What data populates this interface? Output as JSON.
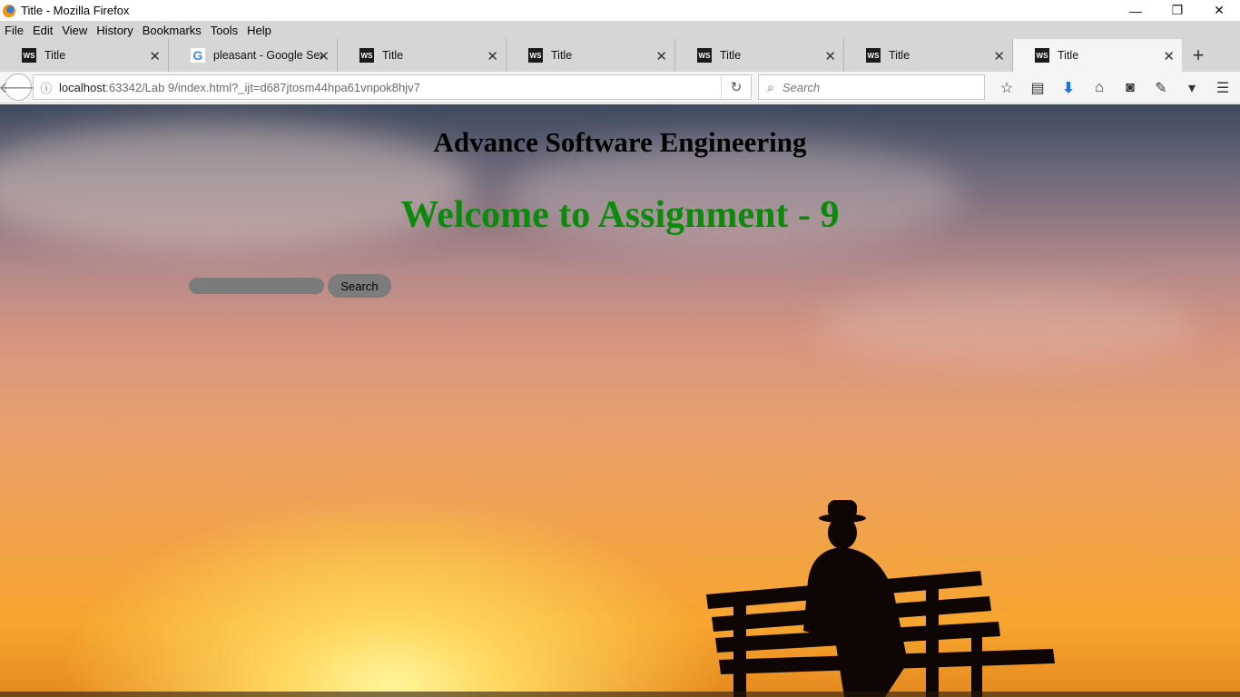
{
  "window": {
    "title": "Title - Mozilla Firefox",
    "controls": {
      "minimize": "—",
      "restore": "❐",
      "close": "✕"
    }
  },
  "menu": [
    {
      "label": "File",
      "key": "F"
    },
    {
      "label": "Edit",
      "key": "E"
    },
    {
      "label": "View",
      "key": "V"
    },
    {
      "label": "History",
      "key": "s"
    },
    {
      "label": "Bookmarks",
      "key": "B"
    },
    {
      "label": "Tools",
      "key": "T"
    },
    {
      "label": "Help",
      "key": "H"
    }
  ],
  "tabs": [
    {
      "label": "Title",
      "icon": "webstorm-icon",
      "active": false
    },
    {
      "label": "pleasant - Google Sea...",
      "icon": "google-icon",
      "active": false
    },
    {
      "label": "Title",
      "icon": "webstorm-icon",
      "active": false
    },
    {
      "label": "Title",
      "icon": "webstorm-icon",
      "active": false
    },
    {
      "label": "Title",
      "icon": "webstorm-icon",
      "active": false
    },
    {
      "label": "Title",
      "icon": "webstorm-icon",
      "active": false
    },
    {
      "label": "Title",
      "icon": "webstorm-icon",
      "active": true
    }
  ],
  "tab_favicon_text": "WS",
  "tab_google_text": "G",
  "navbar": {
    "url_host": "localhost",
    "url_path": ":63342/Lab 9/index.html?_ijt=d687jtosm44hpa61vnpok8hjv7",
    "search_placeholder": "Search"
  },
  "page": {
    "title": "Advance Software Engineering",
    "welcome": "Welcome to Assignment - 9",
    "search_input_value": "",
    "search_button": "Search"
  },
  "colors": {
    "welcome_text": "#0b8a0b",
    "tab_strip": "#d6d6d6",
    "toolbar": "#f5f5f5"
  }
}
